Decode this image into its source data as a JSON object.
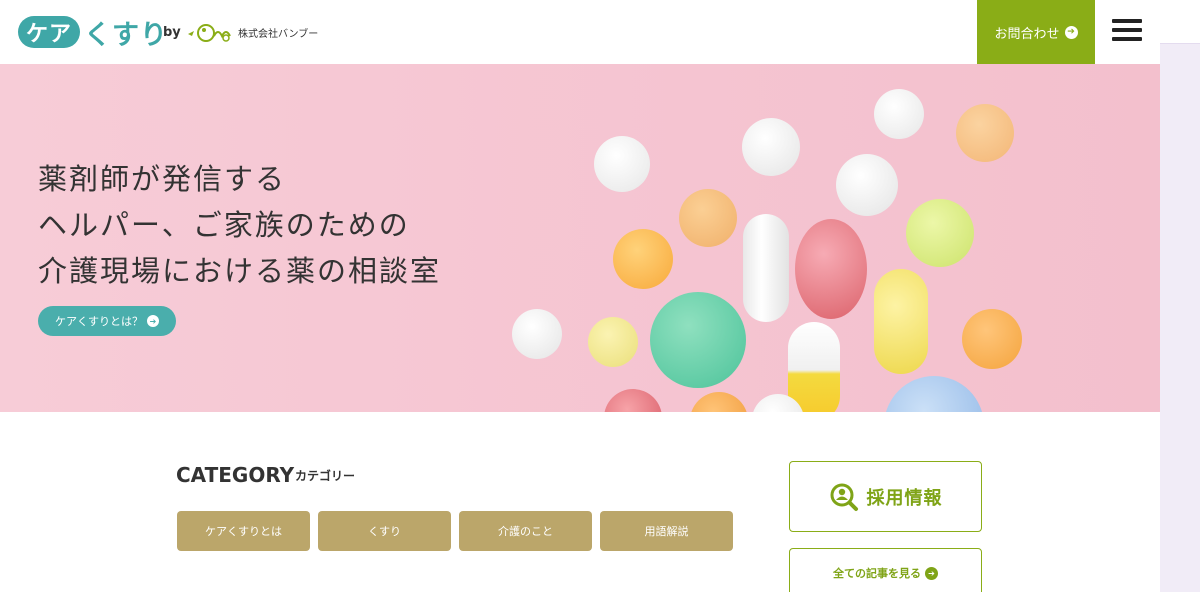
{
  "header": {
    "logo_part1": "ケア",
    "logo_part2": "くすり",
    "by": "by",
    "company": "株式会社バンブー",
    "contact_label": "お問合わせ",
    "arrow_glyph": "➔"
  },
  "hero": {
    "line1": "薬剤師が発信する",
    "line2": "ヘルパー、ご家族のための",
    "line3": "介護現場における薬の相談室",
    "about_label": "ケアくすりとは？"
  },
  "category": {
    "title": "CATEGORY",
    "subtitle": "カテゴリー",
    "items": [
      {
        "label": "ケアくすりとは"
      },
      {
        "label": "くすり"
      },
      {
        "label": "介護のこと"
      },
      {
        "label": "用語解説"
      }
    ]
  },
  "side": {
    "recruit_label": "採用情報",
    "all_articles_label": "全ての記事を見る"
  },
  "colors": {
    "teal": "#3fa7a7",
    "green": "#8aad17",
    "gold": "#bba66a",
    "hero_pink": "#f6c8d4"
  },
  "icons": [
    "hamburger-menu-icon",
    "arrow-circle-icon",
    "search-person-icon",
    "bamboo-logo-icon"
  ]
}
